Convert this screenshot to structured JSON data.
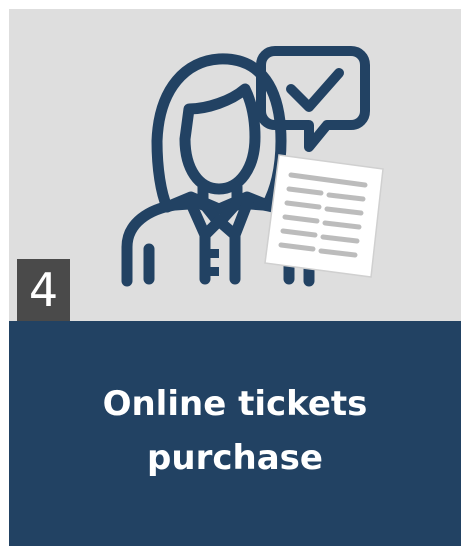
{
  "step": {
    "number": "4"
  },
  "title": {
    "text": "Online tickets purchase"
  },
  "illustration": {
    "icons": [
      "person-icon",
      "speech-bubble-check-icon",
      "document-icon"
    ]
  },
  "colors": {
    "panel_background": "#dedede",
    "title_background": "#224263",
    "icon_stroke": "#224263",
    "badge_background": "#4a4a4a",
    "title_text": "#ffffff"
  }
}
